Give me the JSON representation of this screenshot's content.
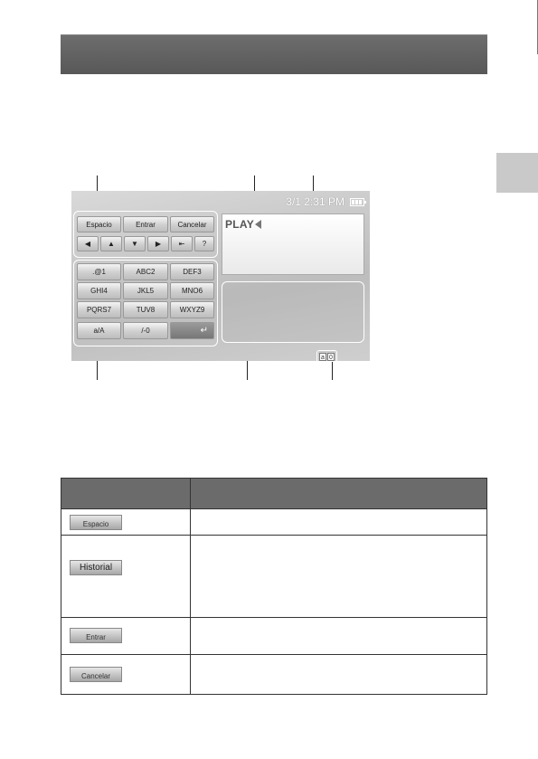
{
  "screen": {
    "datetime": "3/1 2:31 PM",
    "typed_text": "PLAY"
  },
  "control_keys": {
    "space": "Espacio",
    "enter": "Entrar",
    "cancel": "Cancelar",
    "help": "?"
  },
  "char_keys": [
    [
      ".@1",
      "ABC2",
      "DEF3"
    ],
    [
      "GHI4",
      "JKL5",
      "MNO6"
    ],
    [
      "PQRS7",
      "TUV8",
      "WXYZ9"
    ],
    [
      "a/A",
      "/-0",
      ""
    ]
  ],
  "mode_badge": [
    "a",
    "0"
  ],
  "table": {
    "rows": [
      {
        "button": "Espacio"
      },
      {
        "button": "Historial"
      },
      {
        "button": "Entrar"
      },
      {
        "button": "Cancelar"
      }
    ]
  }
}
